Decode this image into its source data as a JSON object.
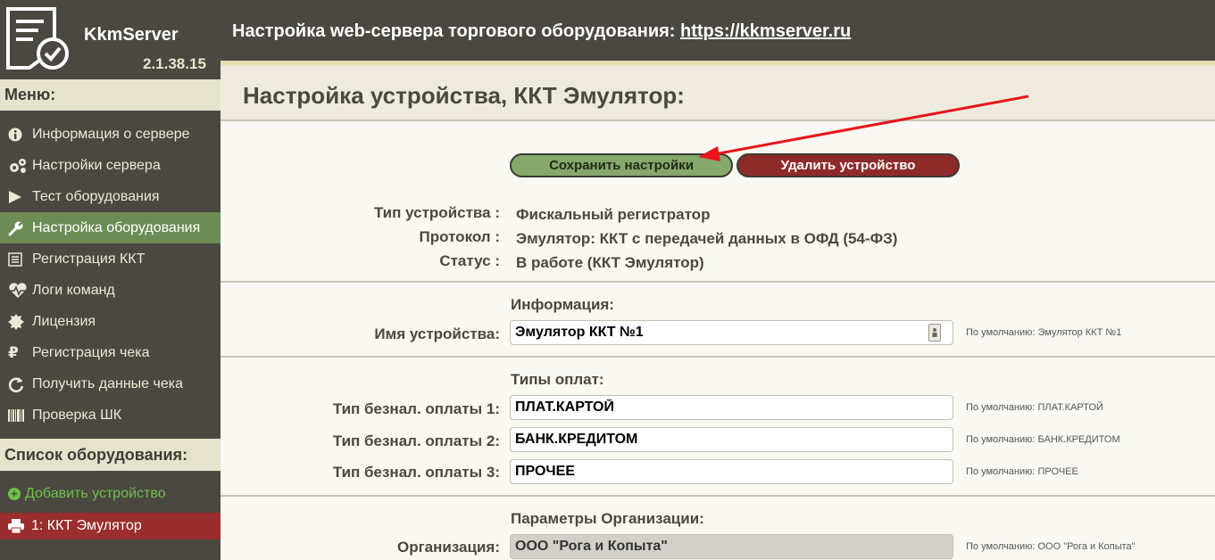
{
  "app": {
    "name": "KkmServer",
    "version": "2.1.38.15"
  },
  "header": {
    "title": "Настройка web-сервера торгового оборудования:",
    "link": "https://kkmserver.ru"
  },
  "sidebar": {
    "menu_title": "Меню:",
    "items": [
      {
        "label": "Информация о сервере",
        "icon": "info-icon"
      },
      {
        "label": "Настройки сервера",
        "icon": "gears-icon"
      },
      {
        "label": "Тест оборудования",
        "icon": "play-icon"
      },
      {
        "label": "Настройка оборудования",
        "icon": "wrench-icon",
        "active": true
      },
      {
        "label": "Регистрация ККТ",
        "icon": "list-icon"
      },
      {
        "label": "Логи команд",
        "icon": "heartbeat-icon"
      },
      {
        "label": "Лицензия",
        "icon": "certificate-icon"
      },
      {
        "label": "Регистрация чека",
        "icon": "ruble-icon"
      },
      {
        "label": "Получить данные чека",
        "icon": "refresh-icon"
      },
      {
        "label": "Проверка ШК",
        "icon": "barcode-icon"
      }
    ],
    "equipment_title": "Список оборудования:",
    "add_device": "Добавить устройство",
    "devices": [
      {
        "label": "1: ККТ Эмулятор",
        "icon": "printer-icon"
      }
    ]
  },
  "main": {
    "title": "Настройка устройства, ККТ Эмулятор:",
    "save_button": "Сохранить настройки",
    "delete_button": "Удалить устройство",
    "info": [
      {
        "label": "Тип устройства :",
        "value": "Фискальный регистратор"
      },
      {
        "label": "Протокол :",
        "value": "Эмулятор: ККТ с передачей данных в ОФД (54-ФЗ)"
      },
      {
        "label": "Статус :",
        "value": "В работе (ККТ Эмулятор)"
      }
    ],
    "sections": {
      "information": {
        "title": "Информация:",
        "device_name": {
          "label": "Имя устройства:",
          "value": "Эмулятор ККТ №1",
          "default": "По умолчанию: Эмулятор ККТ №1"
        }
      },
      "payments": {
        "title": "Типы оплат:",
        "fields": [
          {
            "label": "Тип безнал. оплаты 1:",
            "value": "ПЛАТ.КАРТОЙ",
            "default": "По умолчанию: ПЛАТ.КАРТОЙ"
          },
          {
            "label": "Тип безнал. оплаты 2:",
            "value": "БАНК.КРЕДИТОМ",
            "default": "По умолчанию: БАНК.КРЕДИТОМ"
          },
          {
            "label": "Тип безнал. оплаты 3:",
            "value": "ПРОЧЕЕ",
            "default": "По умолчанию: ПРОЧЕЕ"
          }
        ]
      },
      "organization": {
        "title": "Параметры Организации:",
        "org": {
          "label": "Организация:",
          "value": "ООО \"Рога и Копыта\"",
          "default": "По умолчанию: ООО \"Рога и Копыта\""
        }
      }
    }
  },
  "colors": {
    "dark_bg": "#4a4840",
    "active_item": "#6c8c56",
    "save_button": "#86a86c",
    "delete_button": "#8f2a2a",
    "device_item": "#9a2e2e",
    "annotation_arrow": "#e8141b"
  }
}
